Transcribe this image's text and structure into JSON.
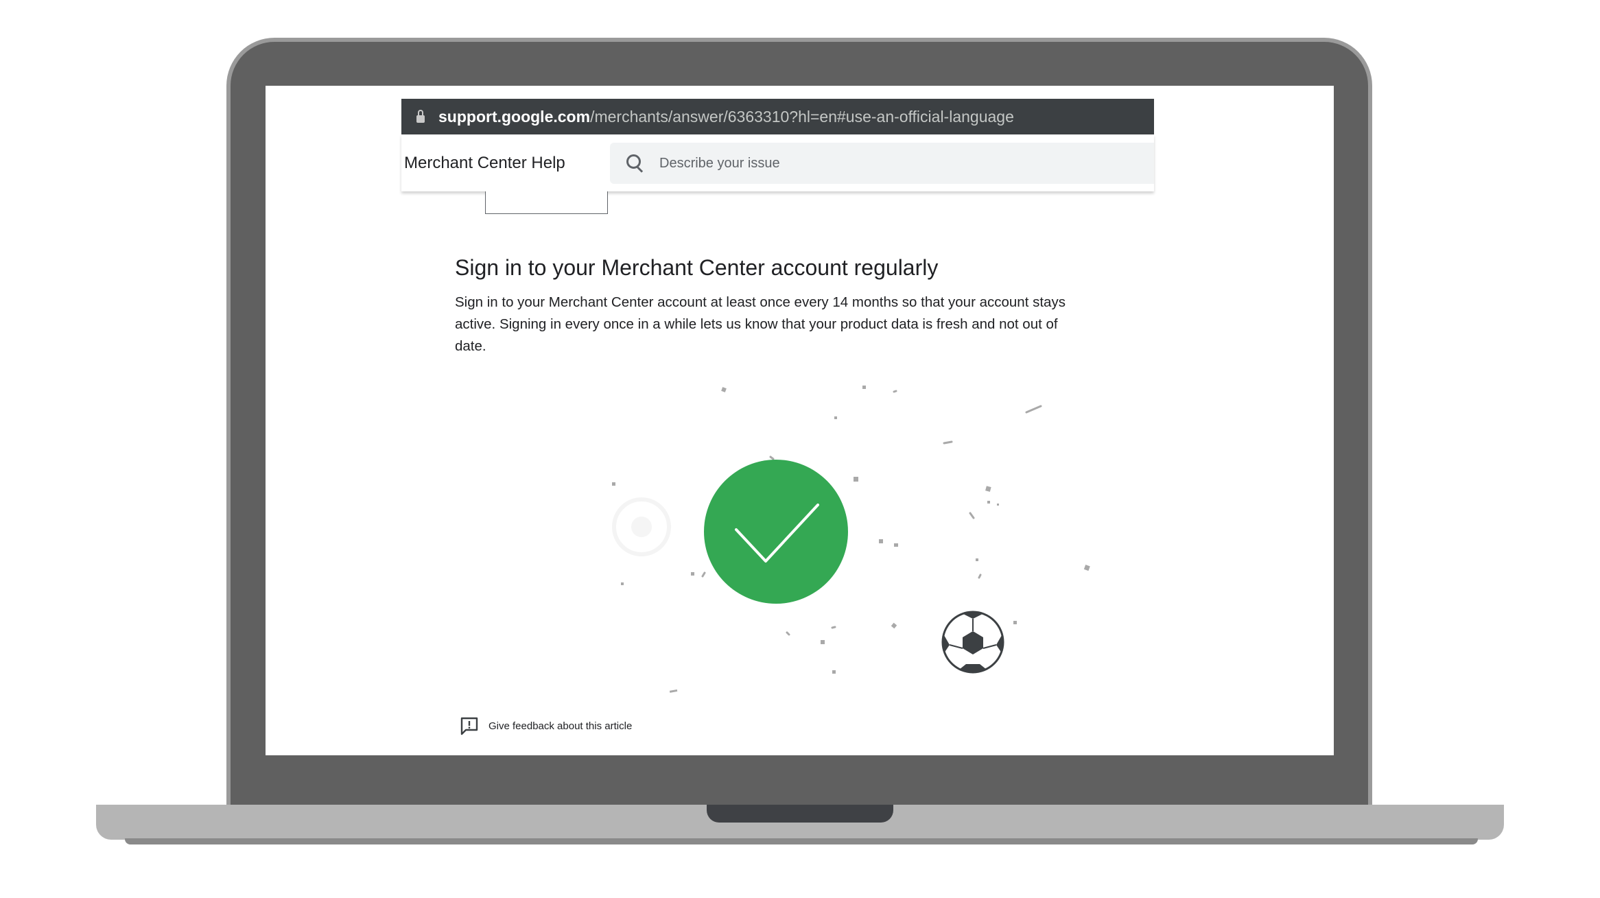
{
  "browser": {
    "url_host": "support.google.com",
    "url_path": "/merchants/answer/6363310?hl=en#use-an-official-language"
  },
  "header": {
    "title": "Merchant Center Help",
    "search_placeholder": "Describe your issue"
  },
  "article": {
    "heading": "Sign in to your Merchant Center account regularly",
    "body": "Sign in to your Merchant Center account at least once every 14 months so that your account stays active. Signing in every once in a while lets us know that your product data is fresh and not out of date."
  },
  "footer": {
    "feedback_label": "Give feedback about this article"
  },
  "colors": {
    "check_green": "#34a853",
    "url_bar": "#3c4043",
    "laptop_frame": "#606060"
  },
  "icons": [
    "lock-icon",
    "search-icon",
    "checkmark-icon",
    "soccer-ball-icon",
    "feedback-icon"
  ]
}
